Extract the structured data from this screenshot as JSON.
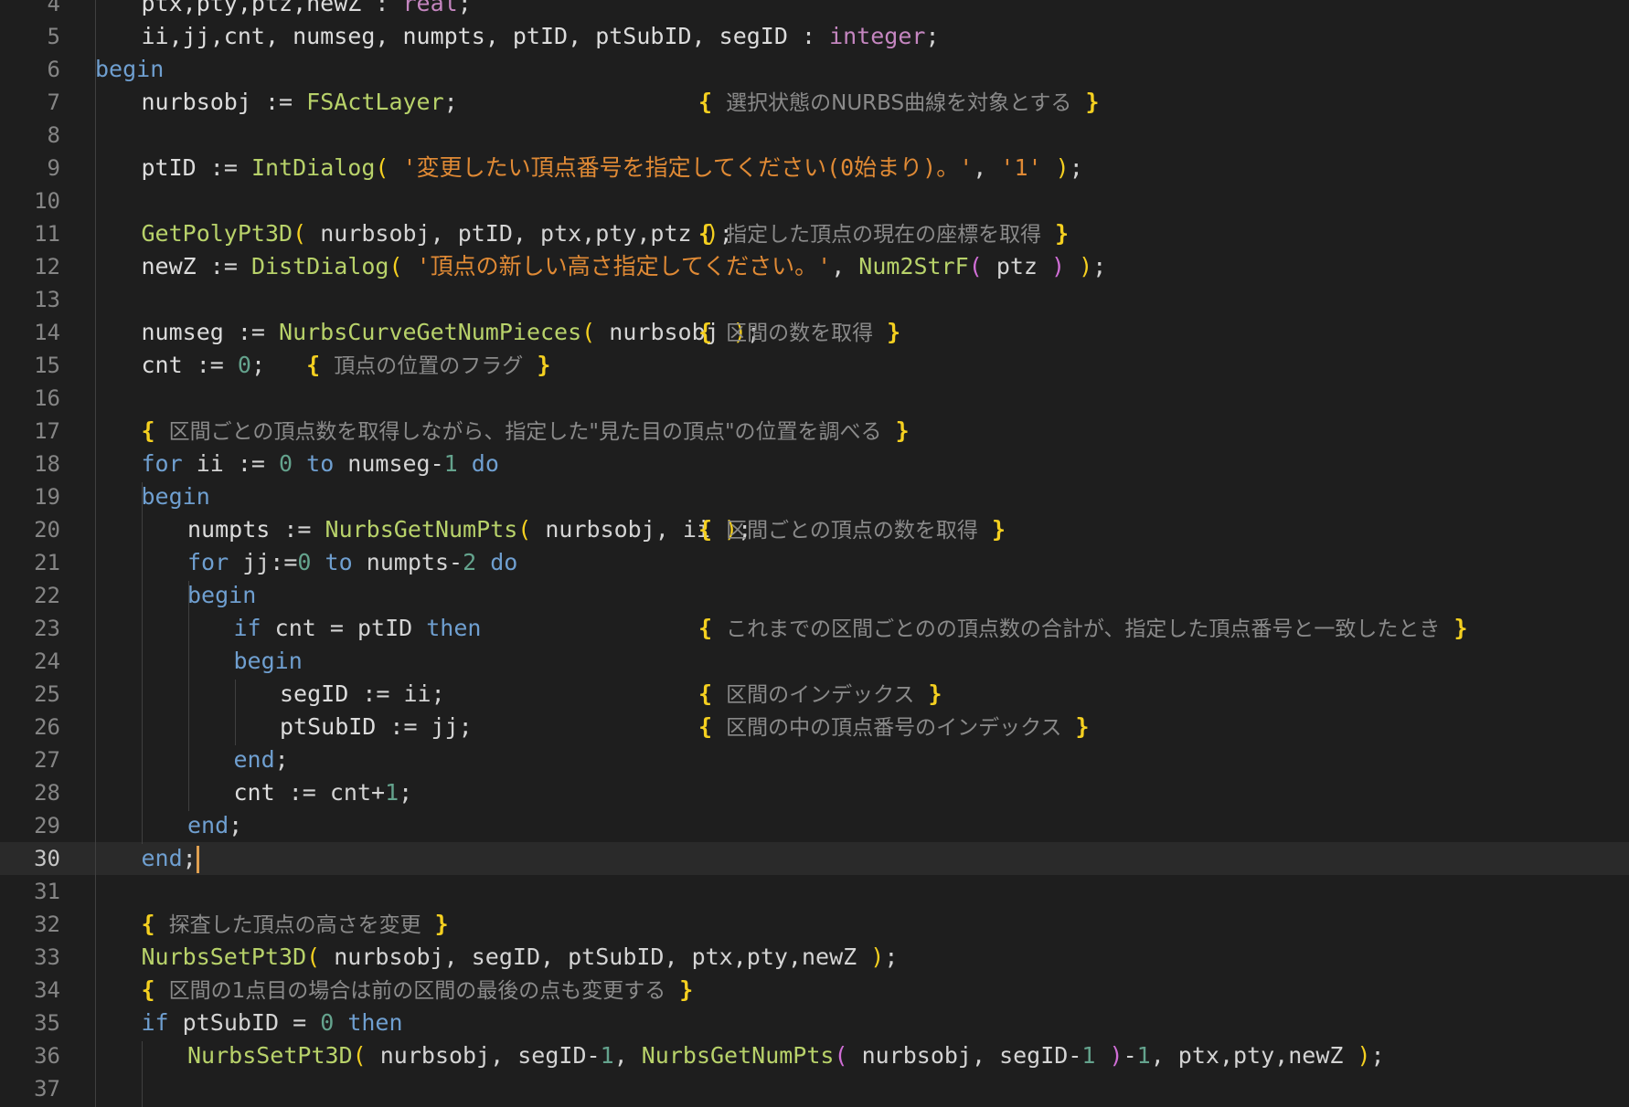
{
  "colors": {
    "background": "#1e1e1e",
    "line_number": "#858585",
    "keyword": "#6f9fd0",
    "type": "#c586c0",
    "function": "#b8d26a",
    "string": "#e08a35",
    "number": "#64a38d",
    "bracket": "#f5d020",
    "bracket_nested": "#d06ed6",
    "comment": "#8a8a8a",
    "cursor": "#e0a050",
    "current_line": "#2a2a2a"
  },
  "editor": {
    "current_line": "30",
    "lines": [
      {
        "n": "4",
        "indent": 1,
        "tokens": [
          [
            "id",
            "ptx,pty,ptz,newZ"
          ],
          [
            "pl",
            " : "
          ],
          [
            "ty",
            "real"
          ],
          [
            "pl",
            ";"
          ]
        ]
      },
      {
        "n": "5",
        "indent": 1,
        "tokens": [
          [
            "id",
            "ii,jj,cnt, numseg, numpts, ptID, ptSubID, segID"
          ],
          [
            "pl",
            " : "
          ],
          [
            "ty",
            "integer"
          ],
          [
            "pl",
            ";"
          ]
        ]
      },
      {
        "n": "6",
        "indent": 0,
        "tokens": [
          [
            "kw",
            "begin"
          ]
        ]
      },
      {
        "n": "7",
        "indent": 1,
        "comment": "選択状態のNURBS曲線を対象とする",
        "tokens": [
          [
            "id",
            "nurbsobj"
          ],
          [
            "pl",
            " := "
          ],
          [
            "fn",
            "FSActLayer"
          ],
          [
            "pl",
            ";"
          ]
        ]
      },
      {
        "n": "8",
        "indent": 1,
        "tokens": []
      },
      {
        "n": "9",
        "indent": 1,
        "tokens": [
          [
            "id",
            "ptID"
          ],
          [
            "pl",
            " := "
          ],
          [
            "fn",
            "IntDialog"
          ],
          [
            "br",
            "("
          ],
          [
            "pl",
            " "
          ],
          [
            "str",
            "'変更したい頂点番号を指定してください(0始まり)。'"
          ],
          [
            "pl",
            ", "
          ],
          [
            "str",
            "'1'"
          ],
          [
            "pl",
            " "
          ],
          [
            "br",
            ")"
          ],
          [
            "pl",
            ";"
          ]
        ]
      },
      {
        "n": "10",
        "indent": 1,
        "tokens": []
      },
      {
        "n": "11",
        "indent": 1,
        "comment": "指定した頂点の現在の座標を取得",
        "tokens": [
          [
            "fn",
            "GetPolyPt3D"
          ],
          [
            "br",
            "("
          ],
          [
            "pl",
            " nurbsobj, ptID, ptx,pty,ptz "
          ],
          [
            "br",
            ")"
          ],
          [
            "pl",
            ";"
          ]
        ]
      },
      {
        "n": "12",
        "indent": 1,
        "tokens": [
          [
            "id",
            "newZ"
          ],
          [
            "pl",
            " := "
          ],
          [
            "fn",
            "DistDialog"
          ],
          [
            "br",
            "("
          ],
          [
            "pl",
            " "
          ],
          [
            "str",
            "'頂点の新しい高さ指定してください。'"
          ],
          [
            "pl",
            ", "
          ],
          [
            "fn",
            "Num2StrF"
          ],
          [
            "br2",
            "("
          ],
          [
            "pl",
            " ptz "
          ],
          [
            "br2",
            ")"
          ],
          [
            "pl",
            " "
          ],
          [
            "br",
            ")"
          ],
          [
            "pl",
            ";"
          ]
        ]
      },
      {
        "n": "13",
        "indent": 1,
        "tokens": []
      },
      {
        "n": "14",
        "indent": 1,
        "comment": "区間の数を取得",
        "tokens": [
          [
            "id",
            "numseg"
          ],
          [
            "pl",
            " := "
          ],
          [
            "fn",
            "NurbsCurveGetNumPieces"
          ],
          [
            "br",
            "("
          ],
          [
            "pl",
            " nurbsobj "
          ],
          [
            "br",
            ")"
          ],
          [
            "pl",
            ";"
          ]
        ]
      },
      {
        "n": "15",
        "indent": 1,
        "inline_comment": "頂点の位置のフラグ",
        "tokens": [
          [
            "id",
            "cnt"
          ],
          [
            "pl",
            " := "
          ],
          [
            "num",
            "0"
          ],
          [
            "pl",
            ";"
          ]
        ]
      },
      {
        "n": "16",
        "indent": 1,
        "tokens": []
      },
      {
        "n": "17",
        "indent": 1,
        "inline_comment": "区間ごとの頂点数を取得しながら、指定した\"見た目の頂点\"の位置を調べる",
        "tokens": []
      },
      {
        "n": "18",
        "indent": 1,
        "tokens": [
          [
            "kw",
            "for"
          ],
          [
            "pl",
            " ii := "
          ],
          [
            "num",
            "0"
          ],
          [
            "pl",
            " "
          ],
          [
            "kw",
            "to"
          ],
          [
            "pl",
            " numseg-"
          ],
          [
            "num",
            "1"
          ],
          [
            "pl",
            " "
          ],
          [
            "kw",
            "do"
          ]
        ]
      },
      {
        "n": "19",
        "indent": 1,
        "tokens": [
          [
            "kw",
            "begin"
          ]
        ]
      },
      {
        "n": "20",
        "indent": 2,
        "comment": "区間ごとの頂点の数を取得",
        "tokens": [
          [
            "id",
            "numpts"
          ],
          [
            "pl",
            " := "
          ],
          [
            "fn",
            "NurbsGetNumPts"
          ],
          [
            "br",
            "("
          ],
          [
            "pl",
            " nurbsobj, ii "
          ],
          [
            "br",
            ")"
          ],
          [
            "pl",
            ";"
          ]
        ]
      },
      {
        "n": "21",
        "indent": 2,
        "tokens": [
          [
            "kw",
            "for"
          ],
          [
            "pl",
            " jj:="
          ],
          [
            "num",
            "0"
          ],
          [
            "pl",
            " "
          ],
          [
            "kw",
            "to"
          ],
          [
            "pl",
            " numpts-"
          ],
          [
            "num",
            "2"
          ],
          [
            "pl",
            " "
          ],
          [
            "kw",
            "do"
          ]
        ]
      },
      {
        "n": "22",
        "indent": 2,
        "tokens": [
          [
            "kw",
            "begin"
          ]
        ]
      },
      {
        "n": "23",
        "indent": 3,
        "comment": "これまでの区間ごとのの頂点数の合計が、指定した頂点番号と一致したとき",
        "tokens": [
          [
            "kw",
            "if"
          ],
          [
            "pl",
            " cnt = ptID "
          ],
          [
            "kw",
            "then"
          ]
        ]
      },
      {
        "n": "24",
        "indent": 3,
        "tokens": [
          [
            "kw",
            "begin"
          ]
        ]
      },
      {
        "n": "25",
        "indent": 4,
        "comment": "区間のインデックス",
        "tokens": [
          [
            "id",
            "segID"
          ],
          [
            "pl",
            " := ii;"
          ]
        ]
      },
      {
        "n": "26",
        "indent": 4,
        "comment": "区間の中の頂点番号のインデックス",
        "tokens": [
          [
            "id",
            "ptSubID"
          ],
          [
            "pl",
            " := jj;"
          ]
        ]
      },
      {
        "n": "27",
        "indent": 3,
        "tokens": [
          [
            "kw",
            "end"
          ],
          [
            "pl",
            ";"
          ]
        ]
      },
      {
        "n": "28",
        "indent": 3,
        "tokens": [
          [
            "id",
            "cnt"
          ],
          [
            "pl",
            " := cnt+"
          ],
          [
            "num",
            "1"
          ],
          [
            "pl",
            ";"
          ]
        ]
      },
      {
        "n": "29",
        "indent": 2,
        "tokens": [
          [
            "kw",
            "end"
          ],
          [
            "pl",
            ";"
          ]
        ]
      },
      {
        "n": "30",
        "indent": 1,
        "cursor": true,
        "tokens": [
          [
            "kw",
            "end"
          ],
          [
            "pl",
            ";"
          ]
        ]
      },
      {
        "n": "31",
        "indent": 1,
        "tokens": []
      },
      {
        "n": "32",
        "indent": 1,
        "inline_comment": "探査した頂点の高さを変更",
        "tokens": []
      },
      {
        "n": "33",
        "indent": 1,
        "tokens": [
          [
            "fn",
            "NurbsSetPt3D"
          ],
          [
            "br",
            "("
          ],
          [
            "pl",
            " nurbsobj, segID, ptSubID, ptx,pty,newZ "
          ],
          [
            "br",
            ")"
          ],
          [
            "pl",
            ";"
          ]
        ]
      },
      {
        "n": "34",
        "indent": 1,
        "inline_comment": "区間の1点目の場合は前の区間の最後の点も変更する",
        "tokens": []
      },
      {
        "n": "35",
        "indent": 1,
        "tokens": [
          [
            "kw",
            "if"
          ],
          [
            "pl",
            " ptSubID = "
          ],
          [
            "num",
            "0"
          ],
          [
            "pl",
            " "
          ],
          [
            "kw",
            "then"
          ]
        ]
      },
      {
        "n": "36",
        "indent": 2,
        "tokens": [
          [
            "fn",
            "NurbsSetPt3D"
          ],
          [
            "br",
            "("
          ],
          [
            "pl",
            " nurbsobj, segID-"
          ],
          [
            "num",
            "1"
          ],
          [
            "pl",
            ", "
          ],
          [
            "fn",
            "NurbsGetNumPts"
          ],
          [
            "br2",
            "("
          ],
          [
            "pl",
            " nurbsobj, segID-"
          ],
          [
            "num",
            "1"
          ],
          [
            "pl",
            " "
          ],
          [
            "br2",
            ")"
          ],
          [
            "pl",
            "-"
          ],
          [
            "num",
            "1"
          ],
          [
            "pl",
            ", ptx,pty,newZ "
          ],
          [
            "br",
            ")"
          ],
          [
            "pl",
            ";"
          ]
        ]
      },
      {
        "n": "37",
        "indent": 2,
        "tokens": []
      }
    ]
  }
}
